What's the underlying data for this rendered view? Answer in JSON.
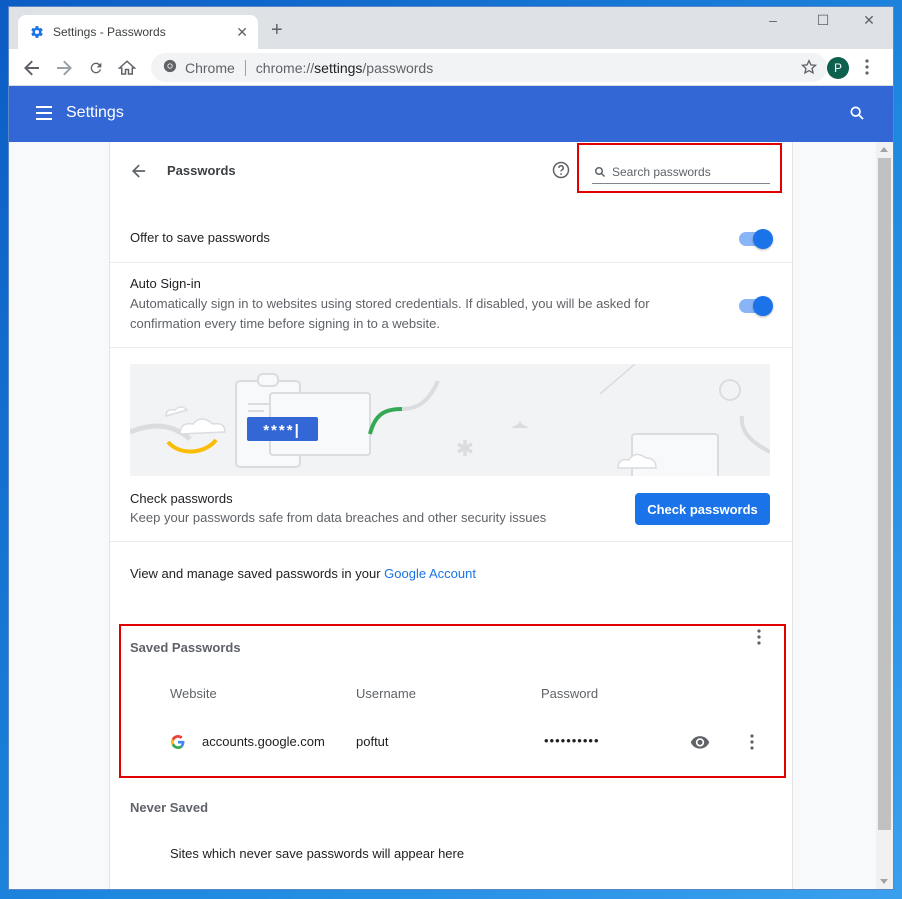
{
  "window": {
    "tab_title": "Settings - Passwords",
    "tab_close": "✕",
    "new_tab": "+"
  },
  "toolbar": {
    "omnibox_label": "Chrome",
    "url_prefix": "chrome://",
    "url_bold": "settings",
    "url_suffix": "/passwords",
    "avatar_letter": "P"
  },
  "appbar": {
    "title": "Settings"
  },
  "passwords": {
    "page_title": "Passwords",
    "search_placeholder": "Search passwords",
    "offer_to_save_label": "Offer to save passwords",
    "offer_to_save_on": true,
    "auto_signin_label": "Auto Sign-in",
    "auto_signin_desc_line1": "Automatically sign in to websites using stored credentials. If disabled, you will be asked for",
    "auto_signin_desc_line2": "confirmation every time before signing in to a website.",
    "auto_signin_on": true,
    "illustration_text": "****|",
    "check_title": "Check passwords",
    "check_desc": "Keep your passwords safe from data breaches and other security issues",
    "check_button": "Check passwords",
    "manage_text": "View and manage saved passwords in your ",
    "manage_link": "Google Account",
    "saved_heading": "Saved Passwords",
    "columns": [
      "Website",
      "Username",
      "Password"
    ],
    "entries": [
      {
        "website": "accounts.google.com",
        "username": "poftut",
        "password": "••••••••••"
      }
    ],
    "never_saved_heading": "Never Saved",
    "never_saved_empty": "Sites which never save passwords will appear here"
  },
  "colors": {
    "accent": "#1a73e8",
    "appbar": "#3367d6",
    "highlight": "#e00000"
  }
}
